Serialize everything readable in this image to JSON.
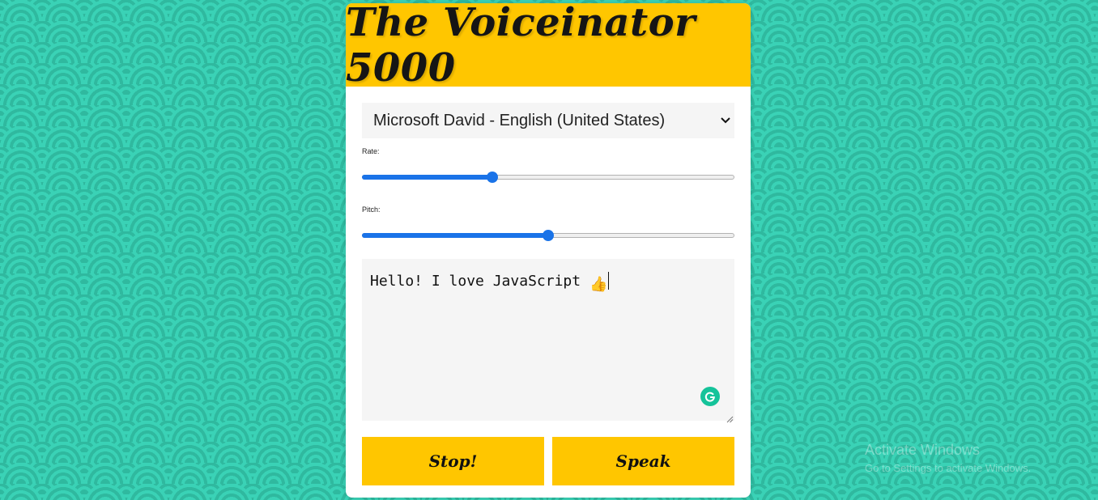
{
  "app": {
    "title": "The Voiceinator 5000"
  },
  "voice_select": {
    "selected": "Microsoft David - English (United States)"
  },
  "rate": {
    "label": "Rate:",
    "value_fraction": 0.345
  },
  "pitch": {
    "label": "Pitch:",
    "value_fraction": 0.5
  },
  "message": {
    "text": "Hello! I love JavaScript ",
    "emoji": "👍"
  },
  "buttons": {
    "stop_label": "Stop!",
    "speak_label": "Speak"
  },
  "watermark": {
    "title": "Activate Windows",
    "subtitle": "Go to Settings to activate Windows."
  },
  "colors": {
    "background": "#34c9ad",
    "accent": "#ffc600",
    "slider": "#1a73e8",
    "grammarly": "#15c39a"
  },
  "icons": {
    "select_arrow": "chevron-down-icon",
    "grammarly": "grammarly-icon",
    "resize": "resize-grip-icon"
  }
}
